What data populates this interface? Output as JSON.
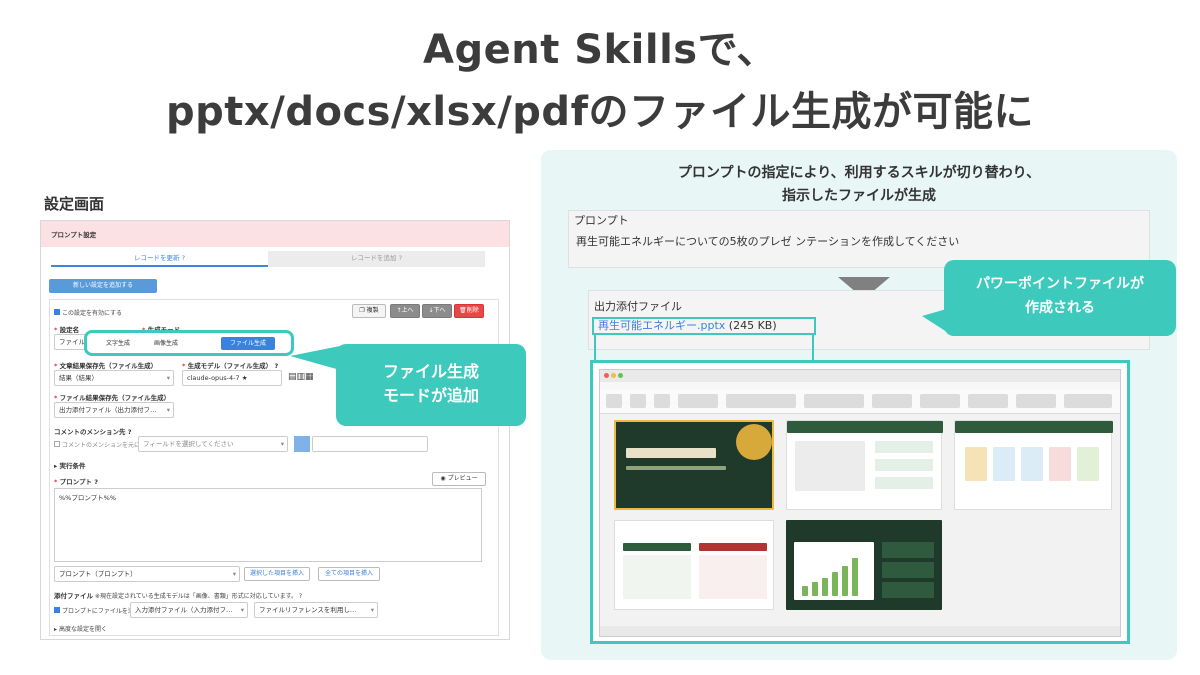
{
  "title": {
    "line1": "Agent Skillsで、",
    "line2": "pptx/docs/xlsx/pdfのファイル生成が可能に"
  },
  "settings_screen": {
    "label": "設定画面",
    "section_header": "プロンプト設定",
    "tab_update": "レコードを更新",
    "tab_add": "レコードを追加",
    "add_setting_button": "新しい設定を追加する",
    "enable_checkbox_label": "この設定を有効にする",
    "duplicate_button": "複製",
    "up_button": "上へ",
    "down_button": "下へ",
    "delete_button": "削除",
    "setting_name_label": "設定名",
    "setting_name_value": "ファイル生成",
    "mode_label": "生成モード",
    "mode_options": [
      "文字生成",
      "画像生成",
      "ファイル生成"
    ],
    "mode_selected": "ファイル生成",
    "text_result_label": "文章結果保存先（ファイル生成）",
    "text_result_value": "結果（結果）",
    "model_label": "生成モデル（ファイル生成）",
    "model_value": "claude-opus-4-7",
    "file_result_label": "ファイル結果保存先（ファイル生成）",
    "file_result_value": "出力添付ファイル（出力添付フ…",
    "comment_mention_label": "コメントのメンション先",
    "comment_mention_checkbox": "コメントのメンションを元に送信する",
    "field_select_placeholder": "フィールドを選択してください",
    "run_condition_label": "実行条件",
    "prompt_label": "プロンプト",
    "preview_button": "プレビュー",
    "prompt_value": "%%プロンプト%%",
    "prompt_field_select": "プロンプト（プロンプト）",
    "insert_selected_button": "選択した項目を挿入",
    "insert_all_button": "全ての項目を挿入",
    "attachment_label": "添付ファイル",
    "attachment_note": "※現在設定されている生成モデルは「画像、書類」形式に対応しています。",
    "attachment_checkbox": "プロンプトにファイルを添付する",
    "input_attachment_value": "入力添付ファイル（入力添付フ…",
    "file_reference_value": "ファイルリファレンスを利用し…",
    "advanced_settings": "高度な設定を開く"
  },
  "callout_mode": {
    "line1": "ファイル生成",
    "line2": "モードが追加"
  },
  "right_panel": {
    "heading_line1": "プロンプトの指定により、利用するスキルが切り替わり、",
    "heading_line2": "指示したファイルが生成",
    "prompt_label": "プロンプト",
    "prompt_value": "再生可能エネルギーについての5枚のプレゼ ンテーションを作成してください",
    "output_label": "出力添付ファイル",
    "output_file_name": "再生可能エネルギー.pptx",
    "output_file_size": "(245 KB)"
  },
  "callout_pptx": {
    "line1": "パワーポイントファイルが",
    "line2": "作成される"
  },
  "colors": {
    "teal": "#3ec9bd",
    "title_text": "#3c3c3c",
    "link_blue": "#3b82e0"
  }
}
